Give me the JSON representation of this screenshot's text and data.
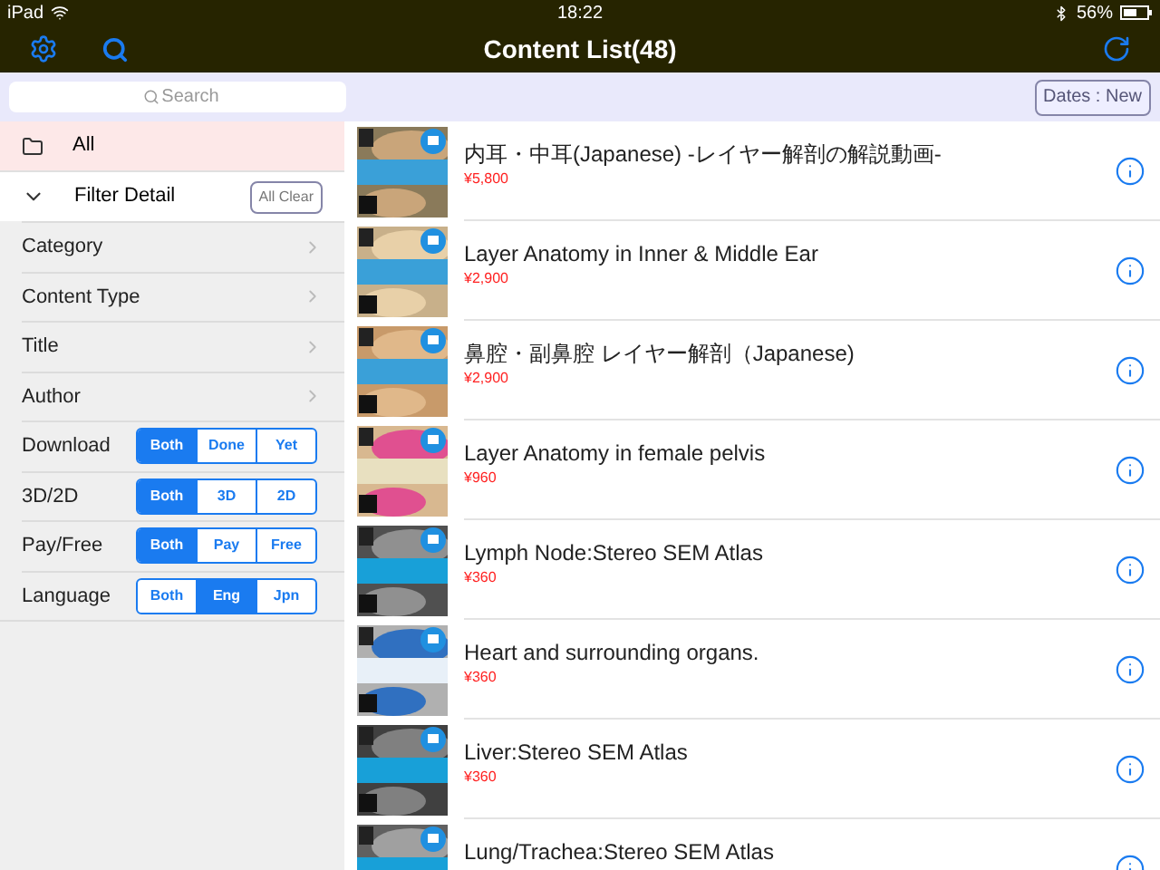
{
  "status_bar": {
    "device": "iPad",
    "time": "18:22",
    "battery": "56%"
  },
  "nav": {
    "title": "Content List(48)"
  },
  "search": {
    "placeholder": "Search"
  },
  "sort_button": "Dates : New",
  "sidebar": {
    "all": {
      "label": "All",
      "selected": true
    },
    "filter": {
      "label": "Filter Detail",
      "expanded": true,
      "clear_button": "All Clear"
    },
    "links": [
      "Category",
      "Content Type",
      "Title",
      "Author"
    ],
    "segments": [
      {
        "label": "Download",
        "options": [
          {
            "label": "Both",
            "selected": true
          },
          {
            "label": "Done",
            "selected": false
          },
          {
            "label": "Yet",
            "selected": false
          }
        ]
      },
      {
        "label": "3D/2D",
        "options": [
          {
            "label": "Both",
            "selected": true
          },
          {
            "label": "3D",
            "selected": false
          },
          {
            "label": "2D",
            "selected": false
          }
        ]
      },
      {
        "label": "Pay/Free",
        "options": [
          {
            "label": "Both",
            "selected": true
          },
          {
            "label": "Pay",
            "selected": false
          },
          {
            "label": "Free",
            "selected": false
          }
        ]
      },
      {
        "label": "Language",
        "options": [
          {
            "label": "Both",
            "selected": false
          },
          {
            "label": "Eng",
            "selected": true
          },
          {
            "label": "Jpn",
            "selected": false
          }
        ]
      }
    ]
  },
  "contents": [
    {
      "title": "内耳・中耳(Japanese) -レイヤー解剖の解説動画-",
      "price": "¥5,800"
    },
    {
      "title": "Layer Anatomy in Inner & Middle Ear",
      "price": "¥2,900"
    },
    {
      "title": "鼻腔・副鼻腔 レイヤー解剖（Japanese)",
      "price": "¥2,900"
    },
    {
      "title": "Layer Anatomy in female pelvis",
      "price": "¥960"
    },
    {
      "title": "Lymph Node:Stereo SEM Atlas",
      "price": "¥360"
    },
    {
      "title": "Heart and surrounding organs.",
      "price": "¥360"
    },
    {
      "title": "Liver:Stereo SEM Atlas",
      "price": "¥360"
    },
    {
      "title": "Lung/Trachea:Stereo SEM Atlas"
    }
  ]
}
